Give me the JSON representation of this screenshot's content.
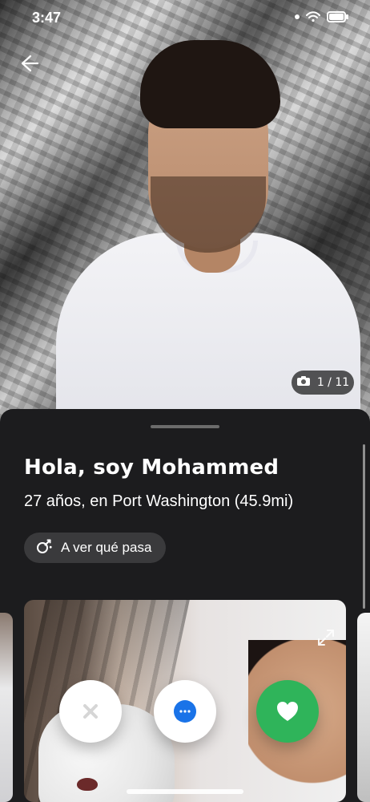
{
  "status_bar": {
    "time": "3:47"
  },
  "hero": {
    "photo_counter": "1 / 11",
    "back_icon": "back-arrow-icon",
    "camera_icon": "camera-icon"
  },
  "profile": {
    "title": "Hola, soy Mohammed",
    "subtitle": "27 años, en Port Washington (45.9mi)",
    "intent": {
      "label": "A ver qué pasa",
      "icon": "intent-icon"
    }
  },
  "actions": {
    "dismiss_icon": "close-icon",
    "message_icon": "chat-icon",
    "like_icon": "heart-icon",
    "like_color": "#2fb45a"
  }
}
